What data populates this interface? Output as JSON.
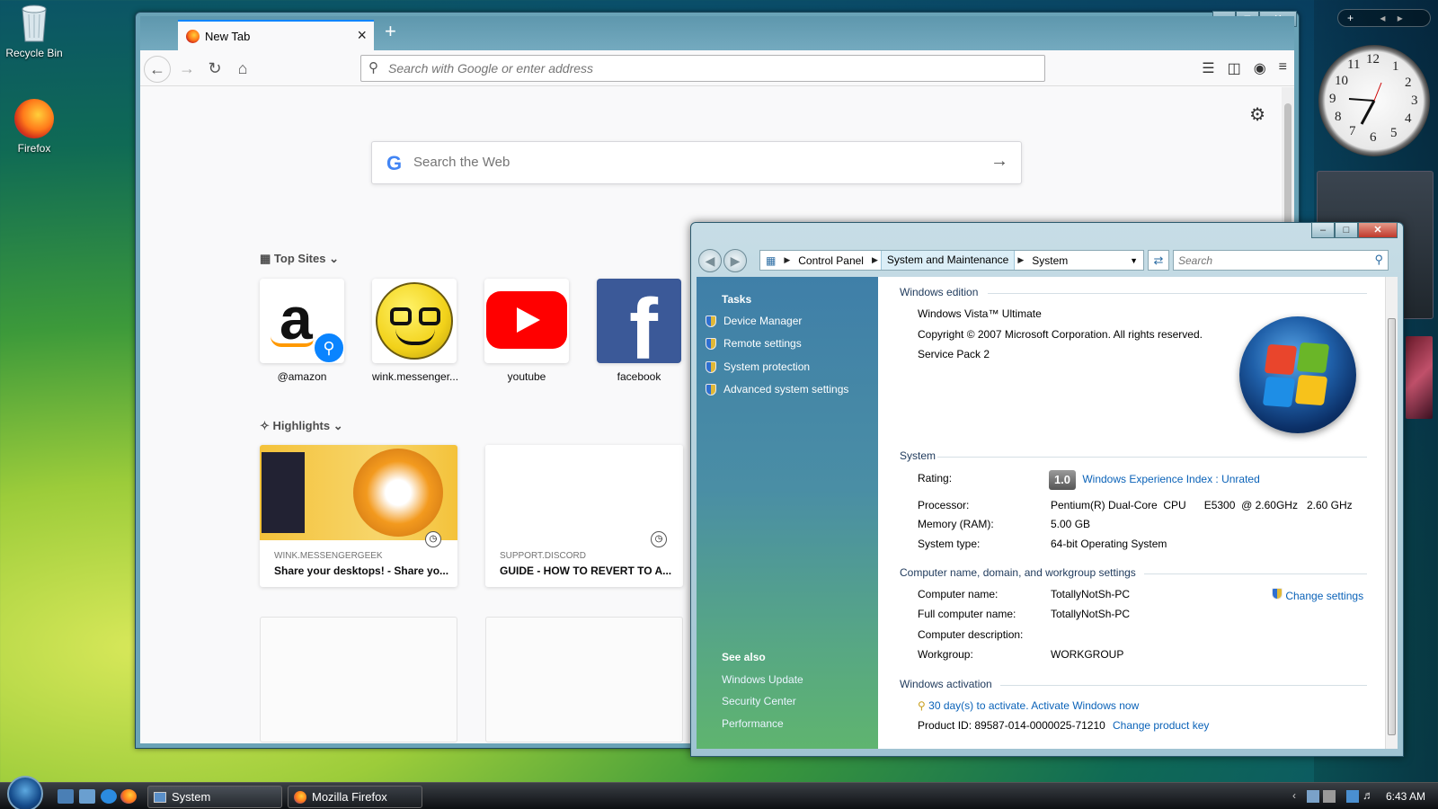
{
  "desktop": {
    "icons": [
      {
        "label": "Recycle Bin"
      },
      {
        "label": "Firefox"
      }
    ]
  },
  "firefox": {
    "tab_title": "New Tab",
    "new_tab_symbol": "+",
    "url_placeholder": "Search with Google or enter address",
    "web_search_placeholder": "Search the Web",
    "top_sites_title": "Top Sites",
    "top_sites": [
      {
        "label": "@amazon",
        "icon": "amazon-logo"
      },
      {
        "label": "wink.messenger...",
        "icon": "nerd-smiley"
      },
      {
        "label": "youtube",
        "icon": "youtube-logo"
      },
      {
        "label": "facebook",
        "icon": "facebook-logo"
      }
    ],
    "highlights_title": "Highlights",
    "highlights": [
      {
        "source": "WINK.MESSENGERGEEK",
        "title": "Share your desktops! - Share yo..."
      },
      {
        "source": "SUPPORT.DISCORD",
        "title": "GUIDE - HOW TO REVERT TO A..."
      }
    ]
  },
  "system_window": {
    "breadcrumb": [
      "Control Panel",
      "System and Maintenance",
      "System"
    ],
    "search_placeholder": "Search",
    "tasks_header": "Tasks",
    "tasks": [
      "Device Manager",
      "Remote settings",
      "System protection",
      "Advanced system settings"
    ],
    "see_also_header": "See also",
    "see_also": [
      "Windows Update",
      "Security Center",
      "Performance"
    ],
    "edition": {
      "header": "Windows edition",
      "name": "Windows Vista™ Ultimate",
      "copyright": "Copyright © 2007 Microsoft Corporation.  All rights reserved.",
      "service_pack": "Service Pack 2"
    },
    "system": {
      "header": "System",
      "rating_label": "Rating:",
      "rating_value": "1.0",
      "rating_link": "Windows Experience Index : Unrated",
      "processor_label": "Processor:",
      "processor_value": "Pentium(R) Dual-Core  CPU      E5300  @ 2.60GHz   2.60 GHz",
      "memory_label": "Memory (RAM):",
      "memory_value": "5.00 GB",
      "type_label": "System type:",
      "type_value": "64-bit Operating System"
    },
    "computer": {
      "header": "Computer name, domain, and workgroup settings",
      "name_label": "Computer name:",
      "name_value": "TotallyNotSh-PC",
      "full_label": "Full computer name:",
      "full_value": "TotallyNotSh-PC",
      "desc_label": "Computer description:",
      "workgroup_label": "Workgroup:",
      "workgroup_value": "WORKGROUP",
      "change_link": "Change settings"
    },
    "activation": {
      "header": "Windows activation",
      "activate_link": "30 day(s) to activate. Activate Windows now",
      "product_id": "Product ID: 89587-014-0000025-71210",
      "change_key_link": "Change product key"
    }
  },
  "taskbar": {
    "buttons": [
      {
        "label": "System"
      },
      {
        "label": "Mozilla Firefox"
      }
    ],
    "time": "6:43 AM"
  },
  "clock_gadget": {
    "numbers": [
      "12",
      "1",
      "2",
      "3",
      "4",
      "5",
      "6",
      "7",
      "8",
      "9",
      "10",
      "11"
    ]
  }
}
